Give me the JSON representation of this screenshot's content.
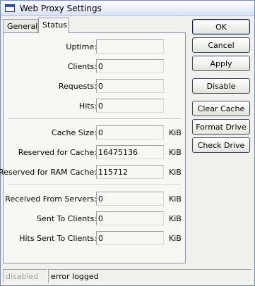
{
  "window": {
    "title": "Web Proxy Settings"
  },
  "tabs": [
    {
      "label": "General",
      "selected": false
    },
    {
      "label": "Status",
      "selected": true
    }
  ],
  "status": {
    "uptime": {
      "label": "Uptime:",
      "value": ""
    },
    "clients": {
      "label": "Clients:",
      "value": "0"
    },
    "requests": {
      "label": "Requests:",
      "value": "0"
    },
    "hits": {
      "label": "Hits:",
      "value": "0"
    },
    "cache_size": {
      "label": "Cache Size:",
      "value": "0",
      "unit": "KiB"
    },
    "reserved_for_cache": {
      "label": "Reserved for Cache:",
      "value": "16475136",
      "unit": "KiB"
    },
    "reserved_for_ram_cache": {
      "label": "Reserved for RAM Cache:",
      "value": "115712",
      "unit": "KiB"
    },
    "received_from_servers": {
      "label": "Received From Servers:",
      "value": "0",
      "unit": "KiB"
    },
    "sent_to_clients": {
      "label": "Sent To Clients:",
      "value": "0",
      "unit": "KiB"
    },
    "hits_sent_to_clients": {
      "label": "Hits Sent To Clients:",
      "value": "0",
      "unit": "KiB"
    }
  },
  "buttons": {
    "ok": "OK",
    "cancel": "Cancel",
    "apply": "Apply",
    "disable": "Disable",
    "clear_cache": "Clear Cache",
    "format_drive": "Format Drive",
    "check_drive": "Check Drive"
  },
  "statusbar": {
    "state": "disabled",
    "message": "error logged"
  }
}
